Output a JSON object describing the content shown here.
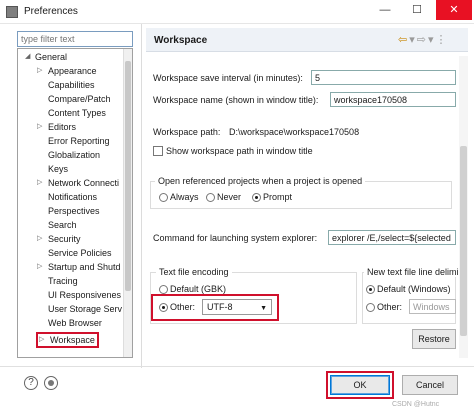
{
  "window": {
    "title": "Preferences",
    "minimize_glyph": "—",
    "maximize_glyph": "☐",
    "close_glyph": "✕"
  },
  "sidebar": {
    "filter_placeholder": "type filter text",
    "items": [
      {
        "label": "General",
        "arrow": "◢"
      },
      {
        "label": "Appearance",
        "arrow": "▷"
      },
      {
        "label": "Capabilities",
        "arrow": ""
      },
      {
        "label": "Compare/Patch",
        "arrow": ""
      },
      {
        "label": "Content Types",
        "arrow": ""
      },
      {
        "label": "Editors",
        "arrow": "▷"
      },
      {
        "label": "Error Reporting",
        "arrow": ""
      },
      {
        "label": "Globalization",
        "arrow": ""
      },
      {
        "label": "Keys",
        "arrow": ""
      },
      {
        "label": "Network Connecti",
        "arrow": "▷"
      },
      {
        "label": "Notifications",
        "arrow": ""
      },
      {
        "label": "Perspectives",
        "arrow": ""
      },
      {
        "label": "Search",
        "arrow": ""
      },
      {
        "label": "Security",
        "arrow": "▷"
      },
      {
        "label": "Service Policies",
        "arrow": ""
      },
      {
        "label": "Startup and Shutd",
        "arrow": "▷"
      },
      {
        "label": "Tracing",
        "arrow": ""
      },
      {
        "label": "UI Responsivenes",
        "arrow": ""
      },
      {
        "label": "User Storage Serv",
        "arrow": ""
      },
      {
        "label": "Web Browser",
        "arrow": ""
      },
      {
        "label": "Workspace",
        "arrow": "▷"
      }
    ]
  },
  "page": {
    "title": "Workspace",
    "nav_back": "⇦",
    "nav_back_menu": "▾",
    "nav_forward": "⇨",
    "nav_forward_menu": "▾",
    "nav_more": "⋮",
    "save_interval_label": "Workspace save interval (in minutes):",
    "save_interval_value": "5",
    "name_label": "Workspace name (shown in window title):",
    "name_value": "workspace170508",
    "path_label": "Workspace path:",
    "path_value": "D:\\workspace\\workspace170508",
    "show_path_label": "Show workspace path in window title",
    "open_group_title": "Open referenced projects when a project is opened",
    "open_options": [
      "Always",
      "Never",
      "Prompt"
    ],
    "open_selected": "Prompt",
    "explorer_label": "Command for launching system explorer:",
    "explorer_value": "explorer /E,/select=${selected",
    "encoding_title": "Text file encoding",
    "encoding_default": "Default (GBK)",
    "encoding_other": "Other:",
    "encoding_value": "UTF-8",
    "newline_title": "New text file line delimi",
    "newline_default": "Default (Windows)",
    "newline_other": "Other:",
    "newline_value": "Windows",
    "restore_label": "Restore"
  },
  "footer": {
    "help_glyph": "?",
    "ok_label": "OK",
    "cancel_label": "Cancel",
    "watermark": "CSDN @Hutnc"
  }
}
